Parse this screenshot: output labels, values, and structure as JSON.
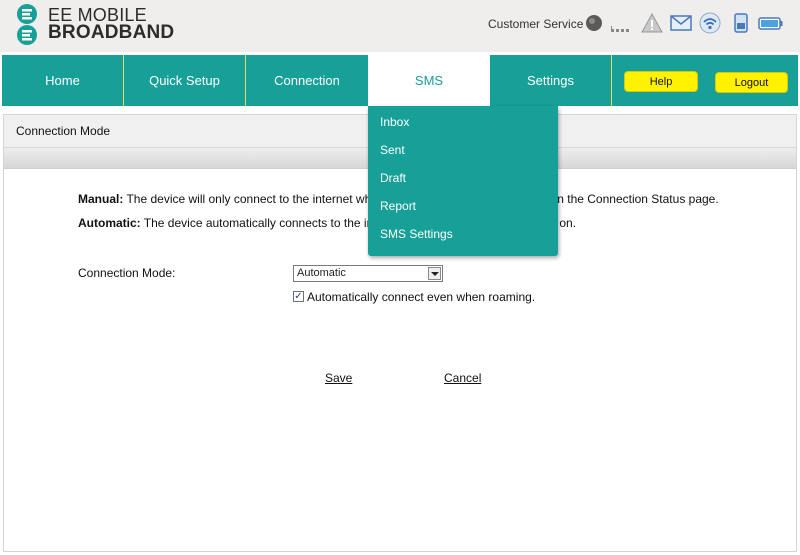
{
  "brand": {
    "line1": "EE MOBILE",
    "line2": "BROADBAND"
  },
  "header": {
    "customer_service": "Customer Service",
    "icons": [
      "signal-status-icon",
      "signal-bars-icon",
      "warning-icon",
      "mail-icon",
      "wifi-icon",
      "sim-icon",
      "battery-icon"
    ]
  },
  "nav": {
    "tabs": [
      {
        "label": "Home"
      },
      {
        "label": "Quick Setup"
      },
      {
        "label": "Connection"
      },
      {
        "label": "SMS"
      },
      {
        "label": "Settings"
      }
    ],
    "active": "SMS",
    "help_label": "Help",
    "logout_label": "Logout"
  },
  "sms_menu": {
    "items": [
      "Inbox",
      "Sent",
      "Draft",
      "Report",
      "SMS Settings"
    ]
  },
  "page": {
    "title": "Connection Mode",
    "manual_label": "Manual:",
    "manual_text": "The device will only connect to the internet when you click the \"Connect\" button on the Connection Status page.",
    "automatic_label": "Automatic:",
    "automatic_text": "The device automatically connects to the internet when the device is switched on.",
    "mode_label": "Connection Mode:",
    "mode_value": "Automatic",
    "roaming_label": "Automatically connect even when roaming.",
    "roaming_checked": true,
    "save_label": "Save",
    "cancel_label": "Cancel"
  },
  "colors": {
    "teal": "#17a097",
    "yellow": "#fff200",
    "header_bg": "#efeeec"
  }
}
